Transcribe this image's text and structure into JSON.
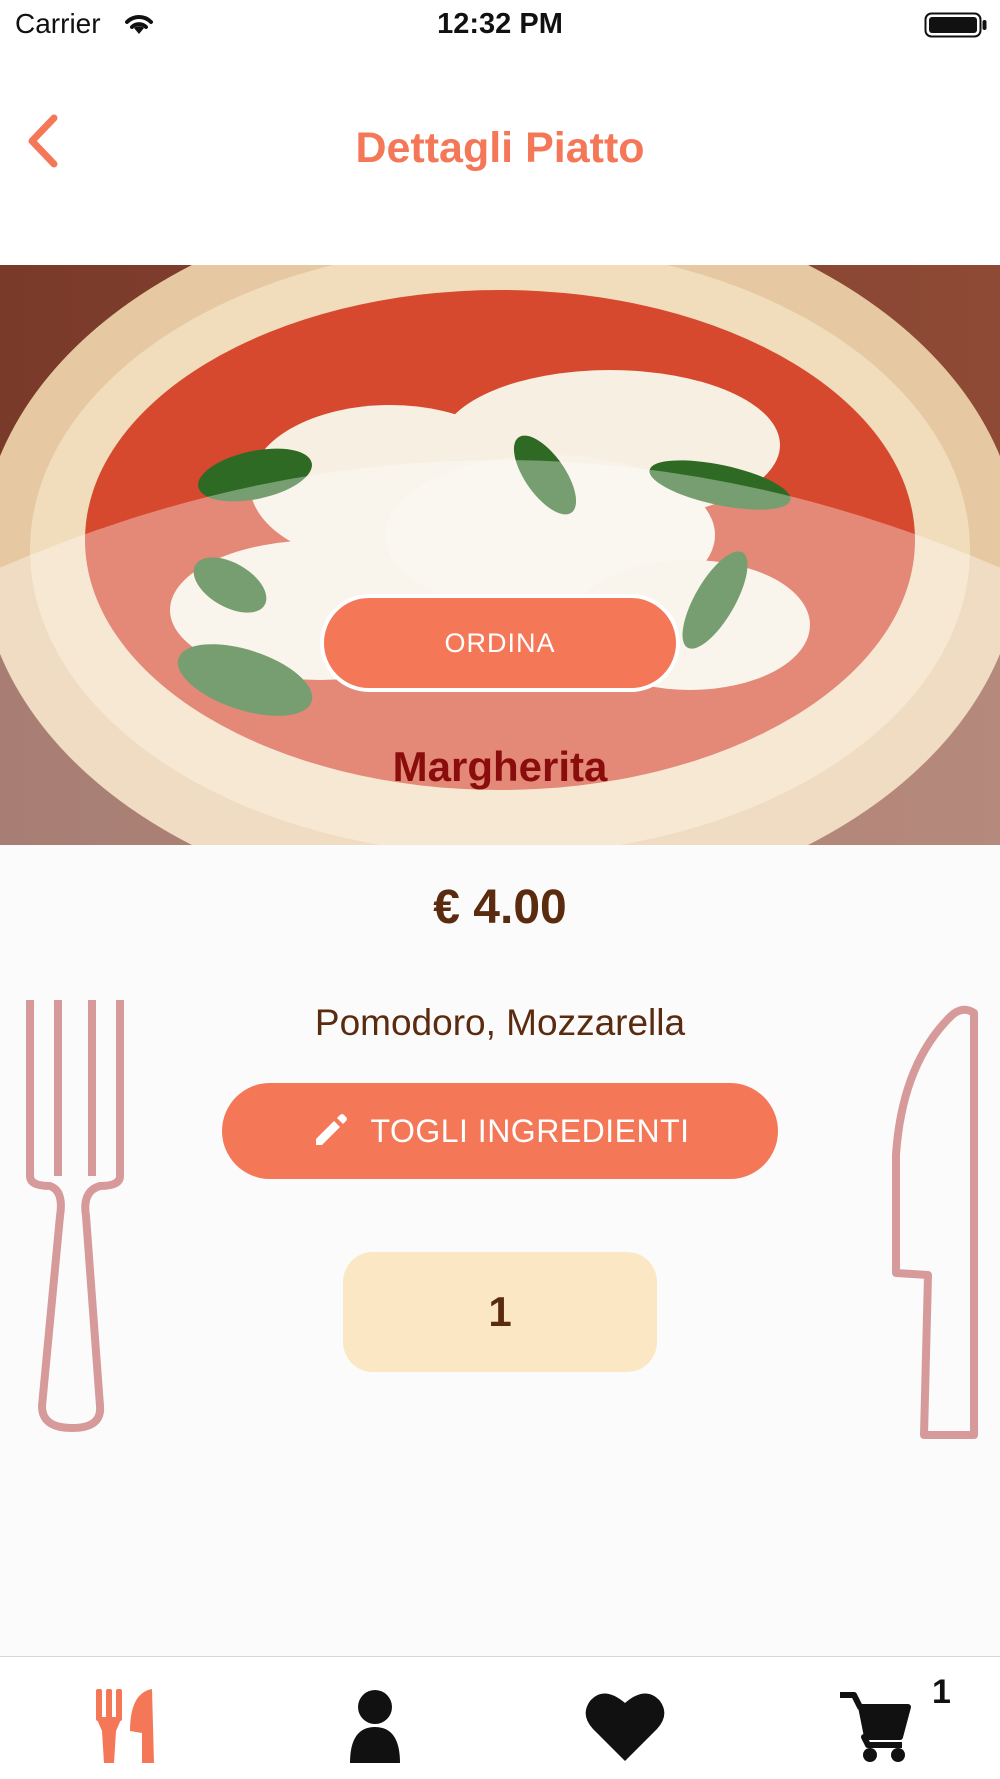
{
  "status_bar": {
    "carrier": "Carrier",
    "time": "12:32 PM"
  },
  "nav": {
    "title": "Dettagli Piatto",
    "back_icon": "chevron-left-icon"
  },
  "dish": {
    "order_label": "ORDINA",
    "name": "Margherita",
    "price": "€ 4.00",
    "ingredients": "Pomodoro, Mozzarella",
    "remove_label": "TOGLI INGREDIENTI",
    "quantity": "1"
  },
  "tab_bar": {
    "items": [
      {
        "icon": "utensils-icon",
        "active": true
      },
      {
        "icon": "user-icon",
        "active": false
      },
      {
        "icon": "heart-icon",
        "active": false
      },
      {
        "icon": "cart-icon",
        "active": false
      }
    ],
    "cart_count": "1"
  },
  "colors": {
    "accent": "#f47858",
    "dish_name": "#8a0d0d",
    "text_brown": "#5a2b0e",
    "quantity_bg": "#fce7c4",
    "decor_pink": "#d79a9a"
  }
}
